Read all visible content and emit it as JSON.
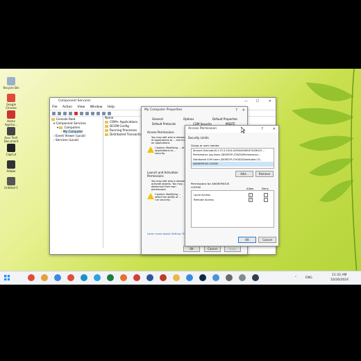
{
  "desktop": {
    "icons": [
      {
        "label": "Recycle Bin",
        "color": "#9bb1c8"
      },
      {
        "label": "Google Chrome",
        "color": "#e14b3b"
      },
      {
        "label": "Home Applica...",
        "color": "#c33"
      },
      {
        "label": "Acer Tech Document",
        "color": "#444"
      },
      {
        "label": "CapCut",
        "color": "#222"
      },
      {
        "label": "Adobe",
        "color": "#333"
      },
      {
        "label": "Untitled 1",
        "color": "#555"
      }
    ]
  },
  "component_services": {
    "title": "Component Services",
    "menu": [
      "File",
      "Action",
      "View",
      "Window",
      "Help"
    ],
    "tree": {
      "root": "Console Root",
      "component_services": "Component Services",
      "computers": "Computers",
      "my_computer": "My Computer",
      "event_viewer": "Event Viewer (Local)",
      "services": "Services (Local)"
    },
    "list_header": "Name",
    "list_items": [
      "COM+ Applications",
      "DCOM Config",
      "Running Processes",
      "Distributed Transaction"
    ]
  },
  "my_computer_properties": {
    "title": "My Computer Properties",
    "help": "?",
    "close": "✕",
    "tabs_row1": [
      "General",
      "Options",
      "Default Properties"
    ],
    "tabs_row2": [
      "Default Protocols",
      "COM Security",
      "MSDTC"
    ],
    "access_section": "Access Permissions",
    "access_text": "You may edit who is allowed ... of applications to ... set limits on applications",
    "access_caution": "Caution: Modifying ... of applications to ... security.",
    "launch_section": "Launch and Activation Permissions",
    "launch_text": "You may edit who is allowed ... activate objects. You may ... determine their own permissions",
    "launch_caution": "Caution: Modifying ... affect the ability of ... run securely.",
    "learn_more": "Learn more about Setting These Properties",
    "ok": "OK",
    "cancel": "Cancel",
    "apply": "Apply"
  },
  "access_permission": {
    "title": "Access Permission",
    "help": "?",
    "close": "✕",
    "section": "Security Limits",
    "group_label": "Group or user names:",
    "users": [
      "Account Unknown(S-1-15-3-1024-2405443489-874036122...",
      "Performance Log Users (DESKTOP-J7V0D2\\Performance...",
      "Distributed COM Users (DESKTOP-J7V0D2\\Distributed CO...",
      "ANONYMOUS LOGON"
    ],
    "add": "Add...",
    "remove": "Remove",
    "perm_label": "Permissions for ANONYMOUS LOGON",
    "allow": "Allow",
    "deny": "Deny",
    "permissions": [
      {
        "name": "Local Access",
        "allow": true,
        "deny": false
      },
      {
        "name": "Remote Access",
        "allow": true,
        "deny": false
      }
    ],
    "ok": "OK",
    "cancel": "Cancel"
  },
  "taskbar": {
    "icons": [
      {
        "name": "chrome-icon",
        "color": "#e14b3b"
      },
      {
        "name": "chrome-icon",
        "color": "#e1a23b"
      },
      {
        "name": "chrome-icon",
        "color": "#3b8ae1"
      },
      {
        "name": "chrome-icon",
        "color": "#e14b3b"
      },
      {
        "name": "edge-icon",
        "color": "#1e90c8"
      },
      {
        "name": "telegram-icon",
        "color": "#2aa3e0"
      },
      {
        "name": "excel-icon",
        "color": "#1e7b45"
      },
      {
        "name": "firefox-icon",
        "color": "#e8702a"
      },
      {
        "name": "app-icon",
        "color": "#d53b3b"
      },
      {
        "name": "word-icon",
        "color": "#2b579a"
      },
      {
        "name": "app-icon",
        "color": "#c0392b"
      },
      {
        "name": "explorer-icon",
        "color": "#e8b84a"
      },
      {
        "name": "chrome-icon",
        "color": "#3b8ae1"
      },
      {
        "name": "photoshop-icon",
        "color": "#0a2a4a"
      },
      {
        "name": "app-icon",
        "color": "#4a90d9"
      },
      {
        "name": "app-icon",
        "color": "#6a6a6a"
      },
      {
        "name": "app-icon",
        "color": "#7f8c8d"
      },
      {
        "name": "app-icon",
        "color": "#2c3e50"
      }
    ],
    "language": "ENG",
    "time": "11:32 AM",
    "date": "10/26/2024"
  }
}
